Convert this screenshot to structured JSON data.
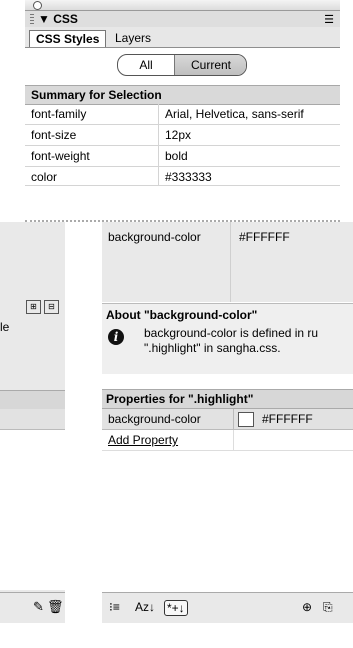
{
  "panel": {
    "title": "CSS",
    "collapse_glyph": "▼",
    "menu_icon_glyph": "☰",
    "tabs": [
      "CSS Styles",
      "Layers"
    ],
    "toggle": {
      "all": "All",
      "current": "Current",
      "selected": "Current"
    }
  },
  "summary": {
    "header": "Summary for Selection",
    "rows": [
      {
        "key": "font-family",
        "value": "Arial, Helvetica, sans-serif"
      },
      {
        "key": "font-size",
        "value": "12px"
      },
      {
        "key": "font-weight",
        "value": "bold"
      }
    ],
    "torn_row": {
      "key": "color",
      "value": "#333333"
    }
  },
  "lower": {
    "bg_row": {
      "key": "background-color",
      "value": "#FFFFFF"
    },
    "left_label": "le",
    "about": {
      "header": "About \"background-color\"",
      "line1": "background-color is defined in ru",
      "line2": "\".highlight\" in sangha.css."
    },
    "properties": {
      "header": "Properties for \".highlight\"",
      "row": {
        "key": "background-color",
        "value": "#FFFFFF",
        "swatch": "#FFFFFF"
      },
      "add_label": "Add Property"
    },
    "bottom_left_icons": [
      "pencil-icon",
      "trash-icon"
    ],
    "bottom_right": {
      "view1": "⁝≡",
      "view2": "Az↓",
      "view3": "*+↓",
      "link": "⊕",
      "attach": "⎘"
    }
  },
  "colors": {
    "panel_gray": "#e9e9e9",
    "header_gray": "#d7d7d7",
    "border": "#aaaaaa"
  }
}
